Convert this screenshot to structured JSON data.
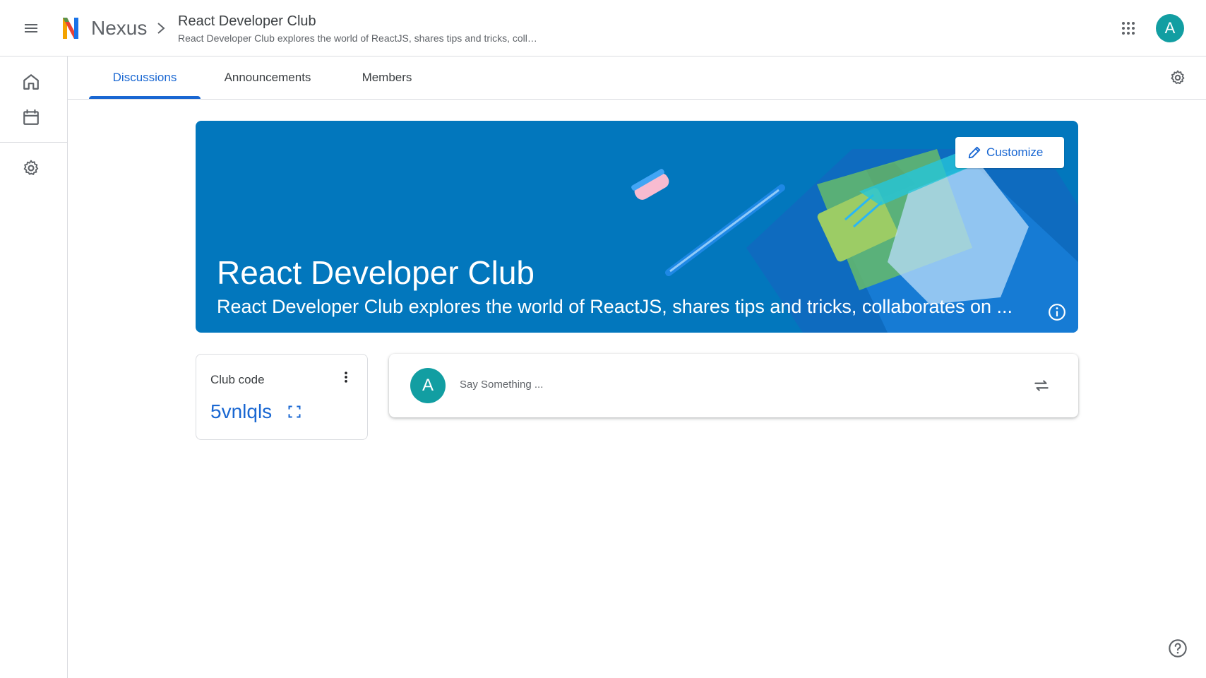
{
  "header": {
    "app_name": "Nexus",
    "breadcrumb_title": "React Developer Club",
    "breadcrumb_subtitle": "React Developer Club explores the world of ReactJS, shares tips and tricks, coll…",
    "avatar_letter": "A",
    "icons": {
      "menu": "hamburger-menu-icon",
      "apps": "google-apps-grid-icon",
      "chevron": "chevron-right-icon"
    }
  },
  "rail": {
    "items": [
      {
        "name": "home",
        "icon": "home-icon"
      },
      {
        "name": "calendar",
        "icon": "calendar-icon"
      },
      {
        "name": "settings",
        "icon": "gear-icon"
      }
    ]
  },
  "tabs": {
    "items": [
      {
        "label": "Discussions",
        "active": true
      },
      {
        "label": "Announcements",
        "active": false
      },
      {
        "label": "Members",
        "active": false
      }
    ],
    "settings_icon": "gear-icon"
  },
  "banner": {
    "title": "React Developer Club",
    "description": "React Developer Club explores the world of ReactJS, shares tips and tricks, collaborates on ...",
    "customize_label": "Customize",
    "background_color": "#0277bd"
  },
  "club_code": {
    "label": "Club code",
    "value": "5vnlqls"
  },
  "post_box": {
    "avatar_letter": "A",
    "placeholder": "Say Something ..."
  },
  "colors": {
    "accent": "#1967d2",
    "avatar": "#129ea2"
  }
}
